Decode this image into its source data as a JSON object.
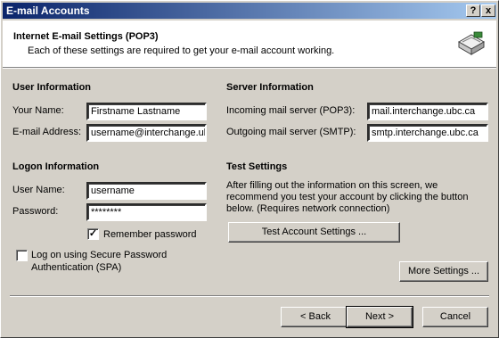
{
  "window": {
    "title": "E-mail Accounts",
    "help_label": "?",
    "close_label": "x"
  },
  "header": {
    "title": "Internet E-mail Settings (POP3)",
    "subtitle": "Each of these settings are required to get your e-mail account working."
  },
  "user_info": {
    "heading": "User Information",
    "name_label": "Your Name:",
    "name_value": "Firstname Lastname",
    "email_label": "E-mail Address:",
    "email_value": "username@interchange.ub"
  },
  "server_info": {
    "heading": "Server Information",
    "incoming_label": "Incoming mail server (POP3):",
    "incoming_value": "mail.interchange.ubc.ca",
    "outgoing_label": "Outgoing mail server (SMTP):",
    "outgoing_value": "smtp.interchange.ubc.ca"
  },
  "logon_info": {
    "heading": "Logon Information",
    "username_label": "User Name:",
    "username_value": "username",
    "password_label": "Password:",
    "password_value": "********",
    "remember_label": "Remember password",
    "remember_checked": true,
    "remember_mark": "✓",
    "spa_label_line1": "Log on using Secure Password",
    "spa_label_line2": "Authentication (SPA)",
    "spa_checked": false
  },
  "test_settings": {
    "heading": "Test Settings",
    "description_line1": "After filling out the information on this screen, we",
    "description_line2": "recommend you test your account by clicking the button",
    "description_line3": "below. (Requires network connection)",
    "test_button": "Test Account Settings ..."
  },
  "buttons": {
    "more_settings": "More Settings ...",
    "back": "< Back",
    "next": "Next >",
    "cancel": "Cancel"
  }
}
